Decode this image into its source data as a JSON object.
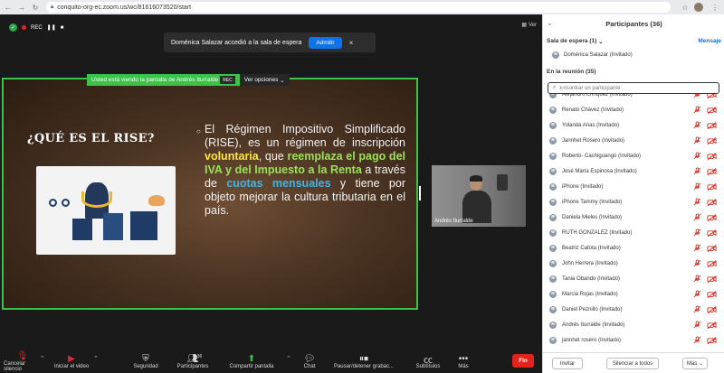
{
  "browser": {
    "url": "conquito-org-ec.zoom.us/wc/81616073520/start"
  },
  "zoom": {
    "rec_label": "REC",
    "view_label": "Ver",
    "toast": {
      "message": "Doménica Salazar accedió a la sala de espera",
      "admit_label": "Admitir",
      "close_label": "×"
    },
    "share_banner": {
      "text": "Usted está viendo la pantalla de Andrés Iturralde",
      "rec_label": "REC",
      "options_label": "Ver opciones"
    },
    "slide": {
      "title": "¿QUÉ ES EL RISE?",
      "text_1": "El Régimen Impositivo Simplificado (RISE), es un régimen de inscripción ",
      "hl_voluntaria": "voluntaria",
      "text_2": ", que ",
      "hl_reemplaza": "reemplaza el pago del IVA y del Impuesto a la Renta",
      "text_3": " a través de ",
      "hl_cuotas": "cuotas mensuales",
      "text_4": " y tiene por objeto mejorar la cultura tributaria en el país."
    },
    "video": {
      "name": "Andrés Iturralde"
    },
    "toolbar": {
      "mute_label": "Cancelar silencio",
      "video_label": "Iniciar el video",
      "security_label": "Seguridad",
      "participants_label": "Participantes",
      "participants_count": "36",
      "share_label": "Compartir pantalla",
      "chat_label": "Chat",
      "record_label": "Pausar/detener grabac...",
      "subtitles_label": "Subtítulos",
      "more_label": "Más",
      "end_label": "Fin"
    }
  },
  "panel": {
    "title": "Participantes (36)",
    "waiting_header": "Sala de espera (1)",
    "message_label": "Mensaje",
    "waiting_name": "Doménica Salazar (Invitado)",
    "in_meeting": "En la reunión (35)",
    "search_placeholder": "Encontrar un participante",
    "participants": [
      {
        "name": "Alejandro Enríquez (Invitado)"
      },
      {
        "name": "Renato Chávez (Invitado)"
      },
      {
        "name": "Yolanda Arias (Invitado)"
      },
      {
        "name": "Jannhet Rosero (Invitado)"
      },
      {
        "name": "Roberto- Cachiguango (Invitado)"
      },
      {
        "name": "José María Espinosa (Invitado)"
      },
      {
        "name": "iPhone (Invitado)"
      },
      {
        "name": "iPhone Tammy (Invitado)"
      },
      {
        "name": "Daniela Mieles (Invitado)"
      },
      {
        "name": "RUTH GONZALEZ (Invitado)"
      },
      {
        "name": "Beatriz Catota (Invitado)"
      },
      {
        "name": "John Herrera (Invitado)"
      },
      {
        "name": "Tania Obando (Invitado)"
      },
      {
        "name": "Marcia Rojas (Invitado)"
      },
      {
        "name": "Daniel Peznillo (Invitado)"
      },
      {
        "name": "Andrés Iturralde (Invitado)"
      },
      {
        "name": "jannhet rosero (Invitado)"
      }
    ],
    "invite_label": "Invitar",
    "mute_all_label": "Silenciar a todos",
    "more_label": "Más"
  },
  "colors": {
    "share_border": "#3cc24a",
    "admit_blue": "#0e72ed",
    "end_red": "#e0241b",
    "muted_red": "#d93025",
    "highlight_yellow": "#ffe640",
    "highlight_green": "#9be15a",
    "highlight_blue": "#3fb6ea"
  }
}
